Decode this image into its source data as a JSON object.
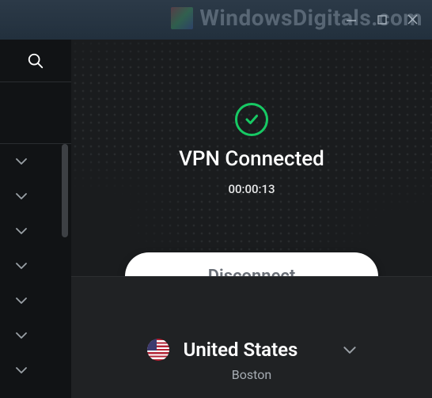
{
  "watermark": "WindowsDigitals.com",
  "status": {
    "title": "VPN Connected",
    "timer": "00:00:13"
  },
  "disconnect_label": "Disconnect",
  "location": {
    "country": "United States",
    "city": "Boston"
  }
}
